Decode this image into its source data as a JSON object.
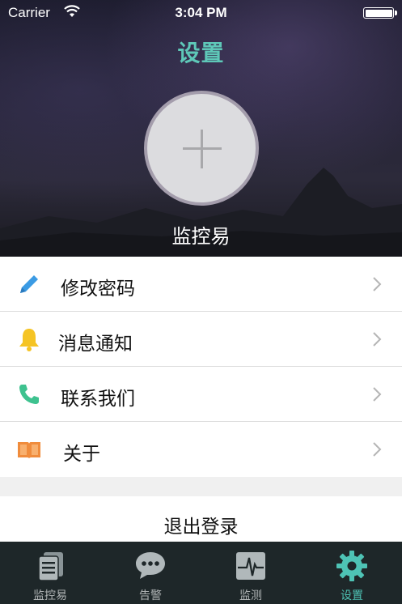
{
  "status_bar": {
    "carrier": "Carrier",
    "time": "3:04 PM"
  },
  "header": {
    "title": "设置",
    "app_name": "监控易",
    "title_color": "#5ec8b8"
  },
  "menu": {
    "items": [
      {
        "label": "修改密码",
        "icon": "pencil-icon",
        "icon_color": "#3b9be4"
      },
      {
        "label": "消息通知",
        "icon": "bell-icon",
        "icon_color": "#f5c425"
      },
      {
        "label": "联系我们",
        "icon": "phone-icon",
        "icon_color": "#3ec28f"
      },
      {
        "label": "关于",
        "icon": "book-icon",
        "icon_color": "#f08c3c"
      }
    ]
  },
  "logout": {
    "label": "退出登录"
  },
  "tabbar": {
    "active_color": "#4ec3b5",
    "tabs": [
      {
        "label": "监控易",
        "icon": "documents-icon",
        "active": false
      },
      {
        "label": "告警",
        "icon": "chat-bubble-icon",
        "active": false
      },
      {
        "label": "监测",
        "icon": "heartbeat-monitor-icon",
        "active": false
      },
      {
        "label": "设置",
        "icon": "gear-icon",
        "active": true
      }
    ]
  }
}
